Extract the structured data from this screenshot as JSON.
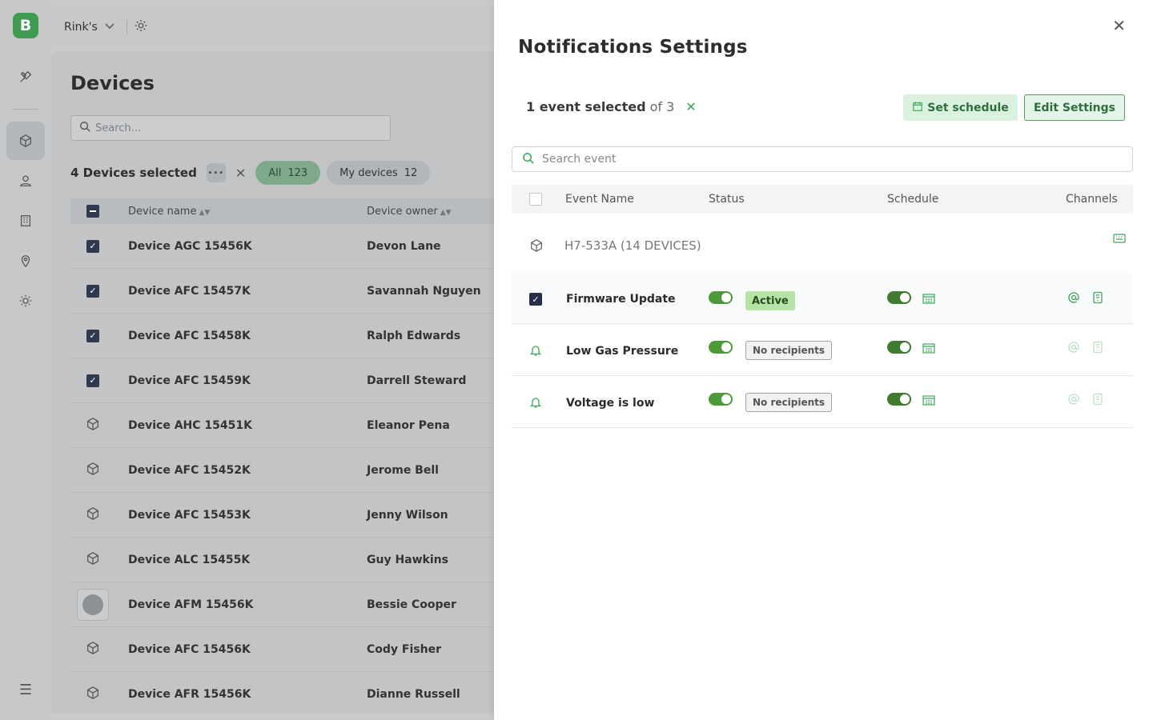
{
  "app": {
    "logo_letter": "B",
    "org_name": "Rink's"
  },
  "rail": {
    "items": [
      {
        "icon": "tools-icon"
      },
      {
        "icon": "cube-icon",
        "active": true
      },
      {
        "icon": "user-icon"
      },
      {
        "icon": "building-icon"
      },
      {
        "icon": "location-pin-icon"
      },
      {
        "icon": "sun-icon"
      }
    ],
    "bottom_icon": "hamburger-menu-icon"
  },
  "devices": {
    "title": "Devices",
    "search_placeholder": "Search...",
    "selected_text": "4 Devices selected",
    "filters": {
      "all_label": "All",
      "all_count": "123",
      "mine_label": "My devices",
      "mine_count": "12"
    },
    "columns": {
      "name": "Device name",
      "owner": "Device owner"
    },
    "rows": [
      {
        "name": "Device AGC 15456K",
        "owner": "Devon Lane",
        "lead": "checked"
      },
      {
        "name": "Device AFC 15457K",
        "owner": "Savannah Nguyen",
        "lead": "checked"
      },
      {
        "name": "Device AFC 15458K",
        "owner": "Ralph Edwards",
        "lead": "checked"
      },
      {
        "name": "Device AFC 15459K",
        "owner": "Darrell Steward",
        "lead": "checked"
      },
      {
        "name": "Device AHC 15451K",
        "owner": "Eleanor Pena",
        "lead": "cube"
      },
      {
        "name": "Device AFC 15452K",
        "owner": "Jerome Bell",
        "lead": "cube"
      },
      {
        "name": "Device AFC 15453K",
        "owner": "Jenny Wilson",
        "lead": "cube"
      },
      {
        "name": "Device ALC 15455K",
        "owner": "Guy Hawkins",
        "lead": "cube"
      },
      {
        "name": "Device AFM 15456K",
        "owner": "Bessie Cooper",
        "lead": "avatar"
      },
      {
        "name": "Device AFC 15456K",
        "owner": "Cody Fisher",
        "lead": "cube"
      },
      {
        "name": "Device AFR 15456K",
        "owner": "Dianne Russell",
        "lead": "cube"
      }
    ]
  },
  "drawer": {
    "title": "Notifications Settings",
    "selection": {
      "selected": "1 event selected",
      "of": "of 3"
    },
    "set_schedule_label": "Set schedule",
    "edit_settings_label": "Edit Settings",
    "search_placeholder": "Search event",
    "columns": {
      "event_name": "Event Name",
      "status": "Status",
      "schedule": "Schedule",
      "channels": "Channels"
    },
    "group_label": "H7-533A (14 DEVICES)",
    "events": [
      {
        "name": "Firmware Update",
        "status_badge": "Active",
        "selected": true
      },
      {
        "name": "Low Gas Pressure",
        "status_badge": "No recipients",
        "selected": false
      },
      {
        "name": "Voltage is low",
        "status_badge": "No recipients",
        "selected": false
      }
    ],
    "colors": {
      "accent_green": "#3fa35a",
      "toggle_green": "#4e9a3a",
      "active_badge": "#b6e3a6"
    }
  }
}
